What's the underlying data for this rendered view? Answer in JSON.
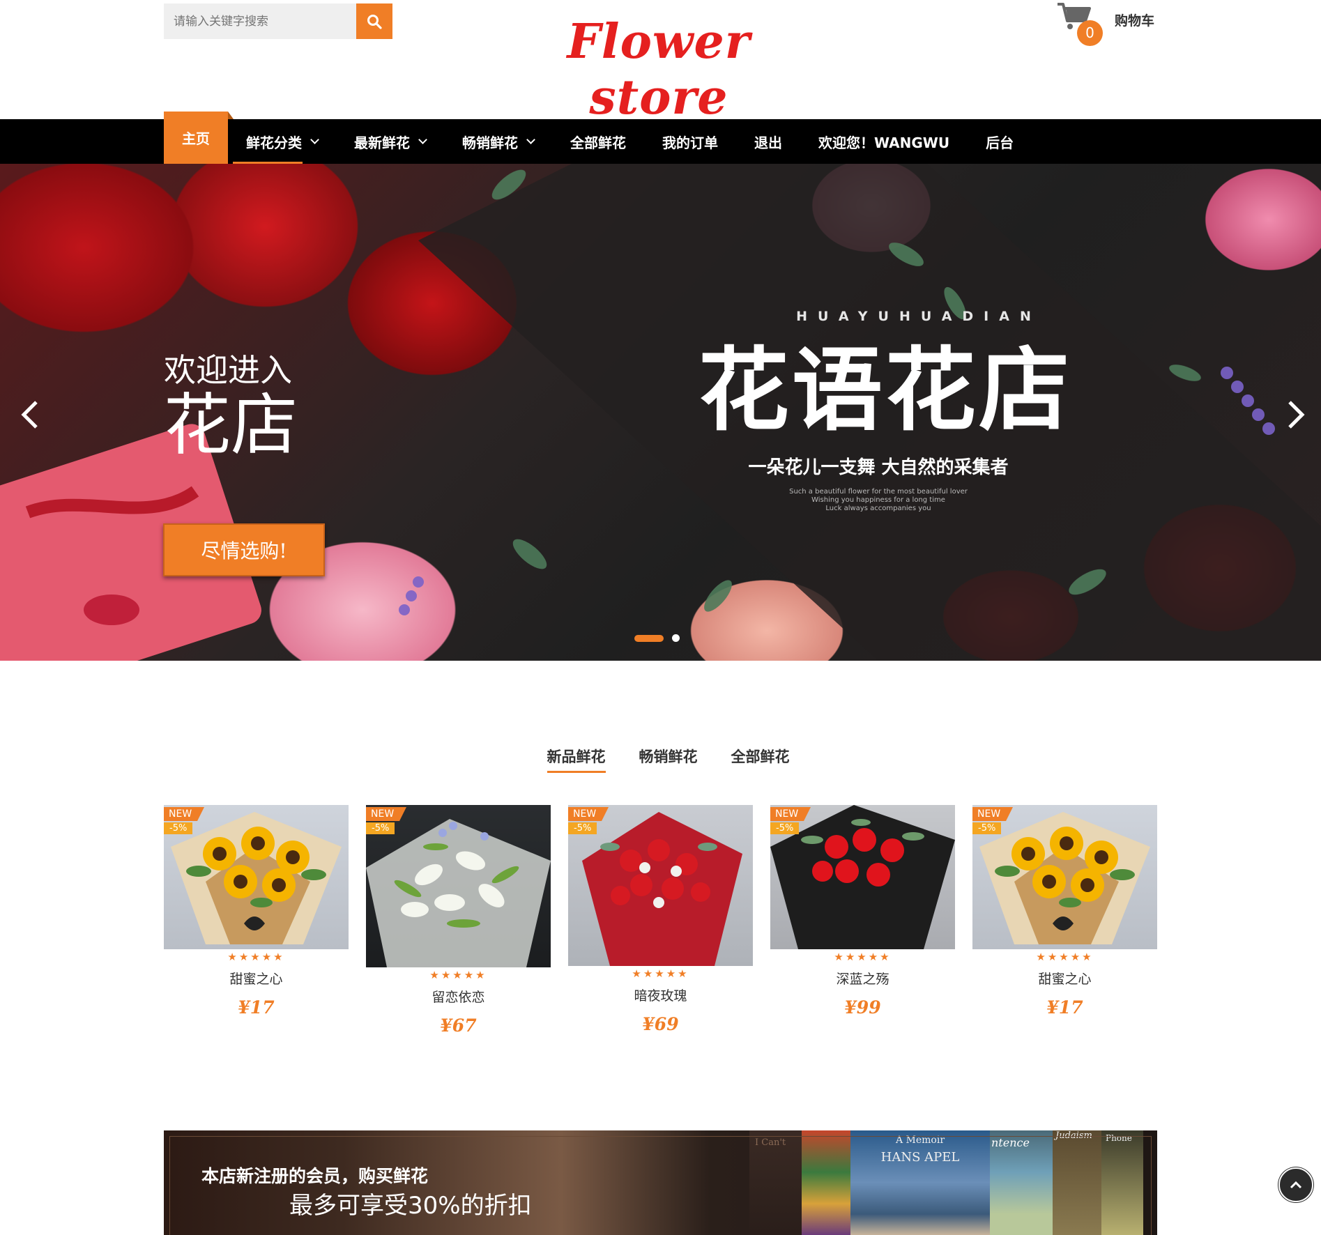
{
  "header": {
    "search_placeholder": "请输入关键字搜索",
    "logo": "Flower store",
    "cart_count": "0",
    "cart_label": "购物车"
  },
  "nav": {
    "items": [
      {
        "label": "主页",
        "active": true
      },
      {
        "label": "鲜花分类",
        "dropdown": true
      },
      {
        "label": "最新鲜花",
        "dropdown": true
      },
      {
        "label": "畅销鲜花",
        "dropdown": true
      },
      {
        "label": "全部鲜花"
      },
      {
        "label": "我的订单"
      },
      {
        "label": "退出"
      },
      {
        "label": "欢迎您！WANGWU"
      },
      {
        "label": "后台"
      }
    ]
  },
  "hero": {
    "subtitle": "欢迎进入",
    "title": "花店",
    "button": "尽情选购!",
    "latin": "HUAYUHUADIAN",
    "big_text": "花语花店",
    "slogan": "一朵花儿一支舞 大自然的采集者",
    "small_lines": [
      "Such a beautiful flower for the most beautiful lover",
      "Wishing you happiness for a long time",
      "Luck always accompanies you"
    ],
    "slide_count": 2,
    "active_slide": 1
  },
  "tabs": [
    "新品鲜花",
    "畅销鲜花",
    "全部鲜花"
  ],
  "products": [
    {
      "name": "甜蜜之心",
      "price": "¥17",
      "badge": "NEW",
      "discount": "-5%",
      "stars": "★★★★★"
    },
    {
      "name": "留恋依恋",
      "price": "¥67",
      "badge": "NEW",
      "discount": "-5%",
      "stars": "★★★★★"
    },
    {
      "name": "暗夜玫瑰",
      "price": "¥69",
      "badge": "NEW",
      "discount": "-5%",
      "stars": "★★★★★"
    },
    {
      "name": "深蓝之殇",
      "price": "¥99",
      "badge": "NEW",
      "discount": "-5%",
      "stars": "★★★★★"
    },
    {
      "name": "甜蜜之心",
      "price": "¥17",
      "badge": "NEW",
      "discount": "-5%",
      "stars": "★★★★★"
    }
  ],
  "banner": {
    "line1": "本店新注册的会员，购买鲜花",
    "line2": "最多可享受30%的折扣",
    "book_texts": [
      "A Memoir",
      "HANS APEL",
      "ntence",
      "Judaism",
      "Phone",
      "I Can't"
    ]
  },
  "colors": {
    "accent": "#f07e26",
    "logo": "#e5201f",
    "nav_bg": "#000000"
  }
}
